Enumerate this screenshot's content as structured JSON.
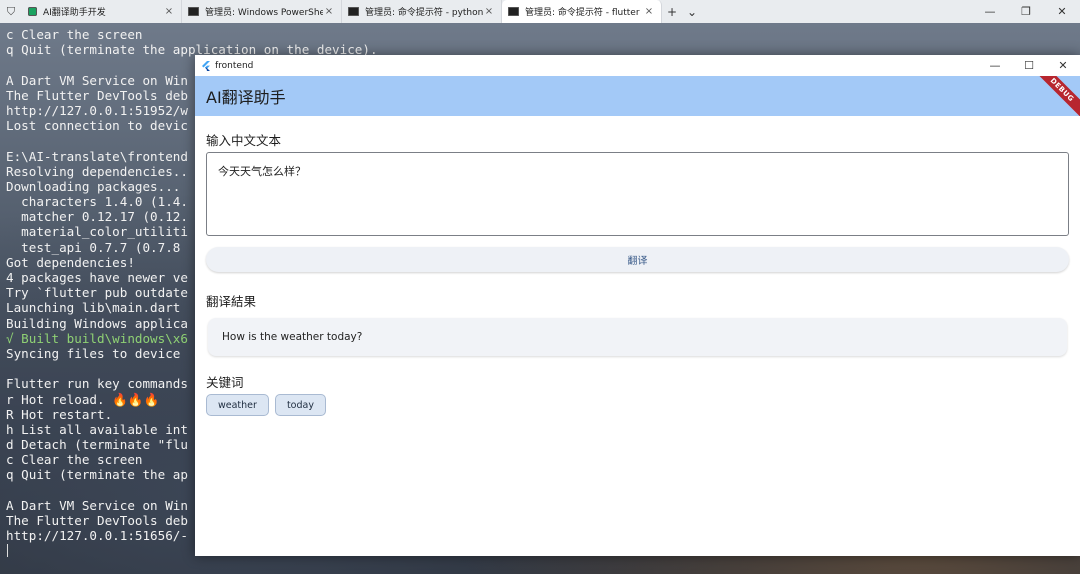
{
  "terminal_tabs": {
    "tabs": [
      {
        "label": "AI翻译助手开发",
        "icon": "green-app-icon",
        "active": false
      },
      {
        "label": "管理员: Windows PowerShell",
        "icon": "terminal-icon",
        "active": false
      },
      {
        "label": "管理员: 命令提示符 - python  m",
        "icon": "terminal-icon",
        "active": false
      },
      {
        "label": "管理员: 命令提示符 - flutter  ru",
        "icon": "terminal-icon",
        "active": true
      }
    ],
    "close_glyph": "×",
    "new_tab_glyph": "+",
    "dropdown_glyph": "⌄",
    "minimize_glyph": "—",
    "restore_glyph": "❐",
    "close_window_glyph": "✕"
  },
  "terminal": {
    "lines": [
      {
        "text": "c Clear the screen",
        "color": "default"
      },
      {
        "text": "q Quit (terminate the application on the device).",
        "color": "default"
      },
      {
        "text": "",
        "color": "default"
      },
      {
        "text": "A Dart VM Service on Win",
        "color": "default"
      },
      {
        "text": "The Flutter DevTools deb",
        "color": "default"
      },
      {
        "text": "http://127.0.0.1:51952/w",
        "color": "default"
      },
      {
        "text": "Lost connection to devic",
        "color": "default"
      },
      {
        "text": "",
        "color": "default"
      },
      {
        "text": "E:\\AI-translate\\frontend",
        "color": "default"
      },
      {
        "text": "Resolving dependencies..",
        "color": "default"
      },
      {
        "text": "Downloading packages...",
        "color": "default"
      },
      {
        "text": "  characters 1.4.0 (1.4.",
        "color": "default"
      },
      {
        "text": "  matcher 0.12.17 (0.12.",
        "color": "default"
      },
      {
        "text": "  material_color_utiliti",
        "color": "default"
      },
      {
        "text": "  test_api 0.7.7 (0.7.8",
        "color": "default"
      },
      {
        "text": "Got dependencies!",
        "color": "default"
      },
      {
        "text": "4 packages have newer ve",
        "color": "default"
      },
      {
        "text": "Try `flutter pub outdate",
        "color": "default"
      },
      {
        "text": "Launching lib\\main.dart",
        "color": "default"
      },
      {
        "text": "Building Windows applica",
        "color": "default"
      },
      {
        "text": "√ Built build\\windows\\x6",
        "color": "green"
      },
      {
        "text": "Syncing files to device",
        "color": "default"
      },
      {
        "text": "",
        "color": "default"
      },
      {
        "text": "Flutter run key commands",
        "color": "default"
      },
      {
        "text": "r Hot reload. 🔥🔥🔥",
        "color": "default"
      },
      {
        "text": "R Hot restart.",
        "color": "default"
      },
      {
        "text": "h List all available int",
        "color": "default"
      },
      {
        "text": "d Detach (terminate \"flu",
        "color": "default"
      },
      {
        "text": "c Clear the screen",
        "color": "default"
      },
      {
        "text": "q Quit (terminate the ap",
        "color": "default"
      },
      {
        "text": "",
        "color": "default"
      },
      {
        "text": "A Dart VM Service on Win",
        "color": "default"
      },
      {
        "text": "The Flutter DevTools deb",
        "color": "default"
      },
      {
        "text": "http://127.0.0.1:51656/-",
        "color": "default"
      }
    ]
  },
  "app_window": {
    "title": "frontend",
    "minimize_glyph": "—",
    "maximize_glyph": "☐",
    "close_glyph": "✕",
    "appbar_title": "AI翻译助手",
    "debug_banner": "DEBUG",
    "input_section_title": "输入中文文本",
    "input_value": "今天天气怎么样？",
    "translate_button": "翻译",
    "result_section_title": "翻译結果",
    "result_text": "How is the weather today?",
    "keywords_section_title": "关键词",
    "keywords": [
      "weather",
      "today"
    ]
  },
  "colors": {
    "appbar": "#a3c9f7",
    "debug_ribbon": "#b7262f",
    "chip_bg": "#dce6f3",
    "button_text": "#3b5c8a"
  }
}
